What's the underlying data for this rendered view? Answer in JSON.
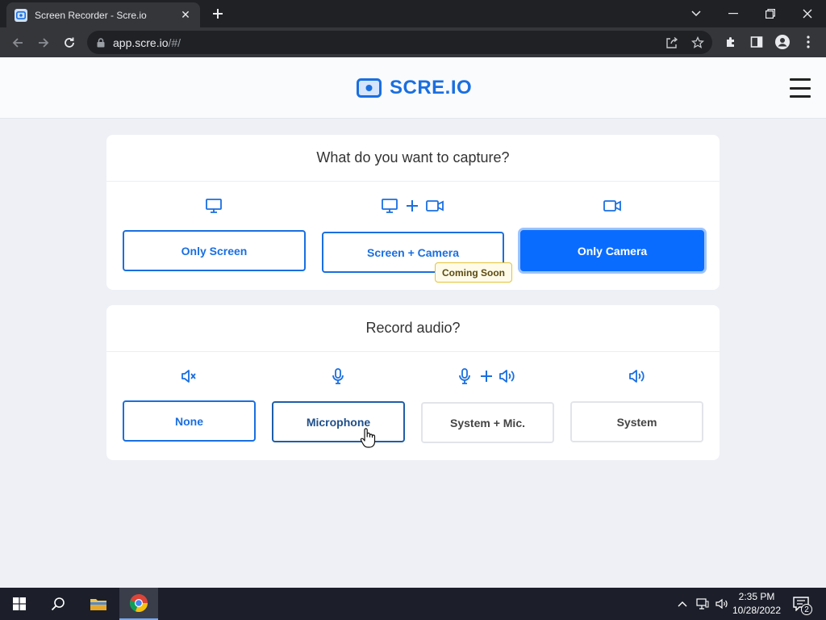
{
  "browser": {
    "tab_title": "Screen Recorder - Scre.io",
    "url_host": "app.scre.io",
    "url_path": "/#/"
  },
  "site": {
    "logo_text": "SCRE.IO",
    "brand_color": "#1a6fe0"
  },
  "capture": {
    "title": "What do you want to capture?",
    "options": [
      {
        "label": "Only Screen",
        "icon": "monitor-icon",
        "state": "default"
      },
      {
        "label": "Screen + Camera",
        "icon": "monitor-plus-camera-icon",
        "state": "disabled"
      },
      {
        "label": "Only Camera",
        "icon": "camera-icon",
        "state": "selected"
      }
    ],
    "badge": "Coming Soon"
  },
  "audio": {
    "title": "Record audio?",
    "options": [
      {
        "label": "None",
        "icon": "mute-icon",
        "state": "default"
      },
      {
        "label": "Microphone",
        "icon": "microphone-icon",
        "state": "hover"
      },
      {
        "label": "System + Mic.",
        "icon": "microphone-plus-speaker-icon",
        "state": "default"
      },
      {
        "label": "System",
        "icon": "speaker-icon",
        "state": "default"
      }
    ]
  },
  "taskbar": {
    "time": "2:35 PM",
    "date": "10/28/2022",
    "notifications": "2"
  }
}
